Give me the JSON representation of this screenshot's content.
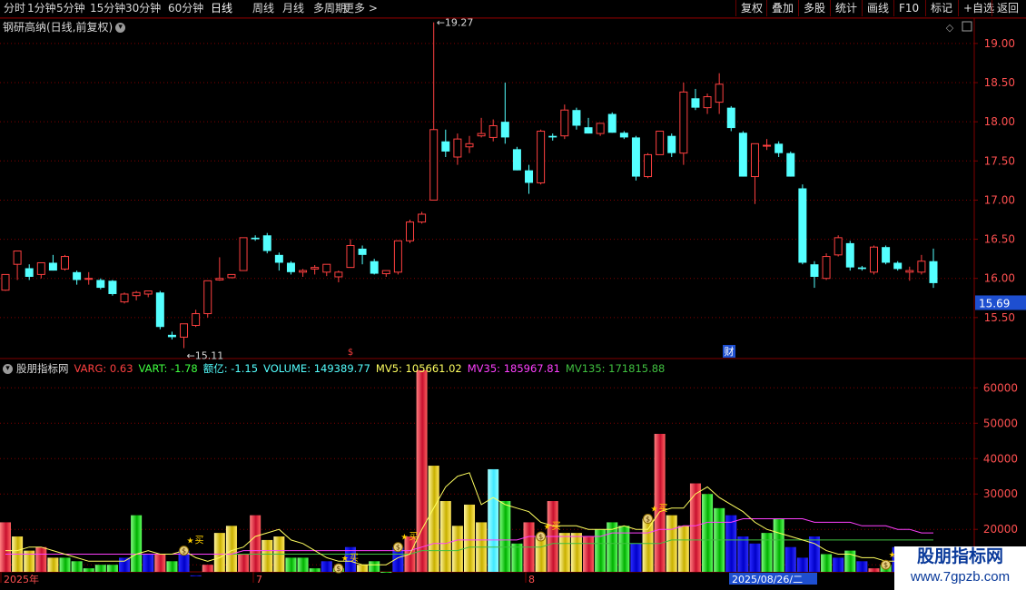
{
  "toolbar": {
    "left": [
      "分时",
      "1分钟",
      "5分钟",
      "15分钟",
      "30分钟",
      "60分钟",
      "日线",
      "周线",
      "月线",
      "多周期",
      "更多 >"
    ],
    "active": "日线",
    "right": [
      "复权",
      "叠加",
      "多股",
      "统计",
      "画线",
      "F10",
      "标记",
      "+自选",
      "返回"
    ]
  },
  "stock_title": "钢研高纳(日线,前复权)",
  "price_axis": {
    "ticks": [
      "19.00",
      "18.50",
      "18.00",
      "17.50",
      "17.00",
      "16.50",
      "16.00",
      "15.50"
    ],
    "current": "15.69",
    "high_label": "19.27",
    "low_label": "15.11"
  },
  "volume_axis": {
    "ticks": [
      "60000",
      "50000",
      "40000",
      "30000",
      "20000",
      "10000"
    ]
  },
  "markers": {
    "dividend": "$",
    "finance": "财"
  },
  "indicator": {
    "name": "股朋指标网",
    "varg": "VARG: 0.63",
    "vart": "VART: -1.78",
    "eyi": "额亿: -1.15",
    "volume": "VOLUME: 149389.77",
    "mv5": "MV5: 105661.02",
    "mv35": "MV35: 185967.81",
    "mv135": "MV135: 171815.88",
    "buy_label": "买"
  },
  "date_axis": {
    "labels": [
      "2025年",
      "7",
      "8"
    ],
    "current_date": "2025/08/26/二"
  },
  "watermark": {
    "line1": "股朋指标网",
    "line2": "www.7gpzb.com"
  },
  "colors": {
    "up": "#ff4040",
    "down": "#54ffff",
    "bg": "#000000",
    "grid": "#800000",
    "mv5": "#ffff60",
    "mv35": "#ff40ff",
    "mv135": "#40c040"
  },
  "chart_data": {
    "type": "candlestick",
    "candles": [
      {
        "o": 15.85,
        "h": 16.05,
        "l": 15.84,
        "c": 16.05
      },
      {
        "o": 16.18,
        "h": 16.35,
        "l": 15.98,
        "c": 16.35
      },
      {
        "o": 16.13,
        "h": 16.18,
        "l": 15.98,
        "c": 16.02
      },
      {
        "o": 16.05,
        "h": 16.2,
        "l": 16.0,
        "c": 16.2
      },
      {
        "o": 16.2,
        "h": 16.3,
        "l": 16.1,
        "c": 16.1
      },
      {
        "o": 16.12,
        "h": 16.3,
        "l": 16.1,
        "c": 16.28
      },
      {
        "o": 16.08,
        "h": 16.1,
        "l": 15.92,
        "c": 15.98
      },
      {
        "o": 16.0,
        "h": 16.08,
        "l": 15.92,
        "c": 16.0
      },
      {
        "o": 15.98,
        "h": 16.0,
        "l": 15.86,
        "c": 15.88
      },
      {
        "o": 15.97,
        "h": 15.98,
        "l": 15.78,
        "c": 15.8
      },
      {
        "o": 15.7,
        "h": 15.82,
        "l": 15.68,
        "c": 15.8
      },
      {
        "o": 15.78,
        "h": 15.84,
        "l": 15.72,
        "c": 15.82
      },
      {
        "o": 15.8,
        "h": 15.84,
        "l": 15.76,
        "c": 15.84
      },
      {
        "o": 15.82,
        "h": 15.84,
        "l": 15.35,
        "c": 15.38
      },
      {
        "o": 15.28,
        "h": 15.32,
        "l": 15.22,
        "c": 15.25
      },
      {
        "o": 15.25,
        "h": 15.42,
        "l": 15.11,
        "c": 15.42
      },
      {
        "o": 15.4,
        "h": 15.6,
        "l": 15.38,
        "c": 15.55
      },
      {
        "o": 15.55,
        "h": 15.97,
        "l": 15.5,
        "c": 15.97
      },
      {
        "o": 15.98,
        "h": 16.27,
        "l": 15.97,
        "c": 16.0
      },
      {
        "o": 16.01,
        "h": 16.05,
        "l": 16.0,
        "c": 16.05
      },
      {
        "o": 16.1,
        "h": 16.52,
        "l": 16.1,
        "c": 16.52
      },
      {
        "o": 16.52,
        "h": 16.55,
        "l": 16.48,
        "c": 16.5
      },
      {
        "o": 16.55,
        "h": 16.58,
        "l": 16.32,
        "c": 16.35
      },
      {
        "o": 16.3,
        "h": 16.33,
        "l": 16.1,
        "c": 16.2
      },
      {
        "o": 16.2,
        "h": 16.22,
        "l": 16.05,
        "c": 16.08
      },
      {
        "o": 16.08,
        "h": 16.12,
        "l": 16.02,
        "c": 16.1
      },
      {
        "o": 16.12,
        "h": 16.17,
        "l": 16.05,
        "c": 16.14
      },
      {
        "o": 16.08,
        "h": 16.18,
        "l": 16.03,
        "c": 16.18
      },
      {
        "o": 16.02,
        "h": 16.1,
        "l": 15.95,
        "c": 16.08
      },
      {
        "o": 16.14,
        "h": 16.5,
        "l": 16.14,
        "c": 16.42
      },
      {
        "o": 16.38,
        "h": 16.42,
        "l": 16.18,
        "c": 16.3
      },
      {
        "o": 16.22,
        "h": 16.25,
        "l": 16.05,
        "c": 16.06
      },
      {
        "o": 16.06,
        "h": 16.1,
        "l": 16.02,
        "c": 16.1
      },
      {
        "o": 16.08,
        "h": 16.48,
        "l": 16.05,
        "c": 16.48
      },
      {
        "o": 16.48,
        "h": 16.75,
        "l": 16.45,
        "c": 16.72
      },
      {
        "o": 16.72,
        "h": 16.85,
        "l": 16.7,
        "c": 16.82
      },
      {
        "o": 17.0,
        "h": 19.27,
        "l": 17.0,
        "c": 17.9
      },
      {
        "o": 17.75,
        "h": 17.9,
        "l": 17.55,
        "c": 17.62
      },
      {
        "o": 17.55,
        "h": 17.85,
        "l": 17.45,
        "c": 17.78
      },
      {
        "o": 17.68,
        "h": 17.82,
        "l": 17.6,
        "c": 17.72
      },
      {
        "o": 17.82,
        "h": 18.05,
        "l": 17.8,
        "c": 17.85
      },
      {
        "o": 17.8,
        "h": 18.03,
        "l": 17.75,
        "c": 17.95
      },
      {
        "o": 18.0,
        "h": 18.5,
        "l": 17.72,
        "c": 17.8
      },
      {
        "o": 17.65,
        "h": 17.68,
        "l": 17.38,
        "c": 17.38
      },
      {
        "o": 17.38,
        "h": 17.45,
        "l": 17.08,
        "c": 17.22
      },
      {
        "o": 17.22,
        "h": 17.9,
        "l": 17.2,
        "c": 17.88
      },
      {
        "o": 17.82,
        "h": 17.85,
        "l": 17.76,
        "c": 17.8
      },
      {
        "o": 17.82,
        "h": 18.22,
        "l": 17.78,
        "c": 18.15
      },
      {
        "o": 18.15,
        "h": 18.18,
        "l": 17.9,
        "c": 17.95
      },
      {
        "o": 17.93,
        "h": 18.05,
        "l": 17.85,
        "c": 17.85
      },
      {
        "o": 17.85,
        "h": 17.98,
        "l": 17.82,
        "c": 17.98
      },
      {
        "o": 18.1,
        "h": 18.12,
        "l": 17.86,
        "c": 17.86
      },
      {
        "o": 17.86,
        "h": 17.88,
        "l": 17.78,
        "c": 17.8
      },
      {
        "o": 17.8,
        "h": 17.82,
        "l": 17.25,
        "c": 17.3
      },
      {
        "o": 17.3,
        "h": 17.6,
        "l": 17.28,
        "c": 17.58
      },
      {
        "o": 17.58,
        "h": 17.88,
        "l": 17.58,
        "c": 17.88
      },
      {
        "o": 17.82,
        "h": 17.85,
        "l": 17.55,
        "c": 17.6
      },
      {
        "o": 17.6,
        "h": 18.5,
        "l": 17.45,
        "c": 18.38
      },
      {
        "o": 18.3,
        "h": 18.42,
        "l": 18.15,
        "c": 18.18
      },
      {
        "o": 18.18,
        "h": 18.36,
        "l": 18.1,
        "c": 18.32
      },
      {
        "o": 18.25,
        "h": 18.62,
        "l": 18.1,
        "c": 18.48
      },
      {
        "o": 18.18,
        "h": 18.2,
        "l": 17.88,
        "c": 17.92
      },
      {
        "o": 17.86,
        "h": 17.88,
        "l": 17.3,
        "c": 17.3
      },
      {
        "o": 17.3,
        "h": 17.72,
        "l": 16.95,
        "c": 17.72
      },
      {
        "o": 17.7,
        "h": 17.78,
        "l": 17.64,
        "c": 17.7
      },
      {
        "o": 17.72,
        "h": 17.75,
        "l": 17.55,
        "c": 17.6
      },
      {
        "o": 17.6,
        "h": 17.62,
        "l": 17.3,
        "c": 17.3
      },
      {
        "o": 17.15,
        "h": 17.2,
        "l": 16.18,
        "c": 16.2
      },
      {
        "o": 16.18,
        "h": 16.22,
        "l": 15.88,
        "c": 16.02
      },
      {
        "o": 16.0,
        "h": 16.32,
        "l": 15.98,
        "c": 16.28
      },
      {
        "o": 16.3,
        "h": 16.55,
        "l": 16.28,
        "c": 16.52
      },
      {
        "o": 16.45,
        "h": 16.48,
        "l": 16.1,
        "c": 16.14
      },
      {
        "o": 16.14,
        "h": 16.16,
        "l": 16.1,
        "c": 16.12
      },
      {
        "o": 16.08,
        "h": 16.42,
        "l": 16.05,
        "c": 16.4
      },
      {
        "o": 16.4,
        "h": 16.42,
        "l": 16.18,
        "c": 16.2
      },
      {
        "o": 16.2,
        "h": 16.22,
        "l": 16.1,
        "c": 16.12
      },
      {
        "o": 16.08,
        "h": 16.15,
        "l": 15.97,
        "c": 16.1
      },
      {
        "o": 16.08,
        "h": 16.3,
        "l": 16.05,
        "c": 16.22
      },
      {
        "o": 16.22,
        "h": 16.38,
        "l": 15.88,
        "c": 15.94
      }
    ],
    "volume": [
      22,
      18,
      14,
      15,
      12,
      12,
      11,
      9,
      10,
      10,
      12,
      24,
      13,
      13,
      11,
      14,
      7,
      10,
      19,
      21,
      13,
      24,
      17,
      18,
      12,
      12,
      9,
      11,
      9,
      15,
      10,
      11,
      8,
      15,
      18,
      65,
      38,
      28,
      21,
      27,
      22,
      37,
      28,
      16,
      22,
      18,
      28,
      19,
      19,
      18,
      20,
      22,
      21,
      16,
      23,
      47,
      24,
      21,
      33,
      30,
      26,
      24,
      18,
      16,
      19,
      23,
      15,
      12,
      18,
      13,
      12,
      14,
      11,
      9,
      10,
      15,
      11,
      9,
      15
    ],
    "mv5": [
      14,
      14,
      15,
      15,
      14,
      13,
      12,
      11,
      11,
      11,
      11,
      13,
      14,
      13,
      13,
      14,
      12,
      11,
      12,
      14,
      15,
      18,
      19,
      20,
      17,
      16,
      14,
      12,
      11,
      11,
      10,
      10,
      10,
      12,
      13,
      20,
      26,
      32,
      35,
      36,
      27,
      29,
      27,
      26,
      25,
      22,
      21,
      21,
      21,
      20,
      20,
      20,
      21,
      20,
      20,
      25,
      26,
      26,
      30,
      32,
      29,
      27,
      25,
      22,
      20,
      19,
      18,
      17,
      16,
      14,
      13,
      13,
      12,
      12,
      11,
      11,
      10,
      10,
      11
    ],
    "mv35": [
      13,
      13,
      13,
      13,
      13,
      13,
      13,
      13,
      13,
      13,
      13,
      13,
      13,
      13,
      13,
      13,
      13,
      13,
      13,
      13,
      14,
      14,
      14,
      14,
      14,
      14,
      14,
      14,
      14,
      14,
      14,
      14,
      14,
      14,
      14,
      15,
      16,
      16,
      17,
      17,
      17,
      17,
      17,
      17,
      18,
      18,
      18,
      18,
      18,
      18,
      18,
      19,
      19,
      19,
      19,
      20,
      20,
      21,
      21,
      22,
      22,
      22,
      23,
      23,
      23,
      23,
      23,
      23,
      22,
      22,
      22,
      22,
      21,
      21,
      21,
      20,
      20,
      19,
      19
    ],
    "mv135": [
      13,
      13,
      13,
      13,
      13,
      13,
      13,
      13,
      13,
      13,
      13,
      13,
      13,
      13,
      13,
      13,
      13,
      13,
      13,
      13,
      13,
      13,
      13,
      13,
      13,
      13,
      13,
      13,
      13,
      13,
      13,
      13,
      13,
      13,
      13,
      14,
      14,
      14,
      14,
      15,
      15,
      15,
      15,
      15,
      15,
      15,
      16,
      16,
      16,
      16,
      16,
      16,
      16,
      16,
      16,
      16,
      17,
      17,
      17,
      17,
      17,
      17,
      17,
      17,
      17,
      17,
      17,
      17,
      17,
      17,
      17,
      17,
      17,
      17,
      17,
      17,
      17,
      17,
      17
    ],
    "vol_colors": [
      "r",
      "y",
      "y",
      "r",
      "y",
      "g",
      "g",
      "g",
      "g",
      "g",
      "b",
      "g",
      "b",
      "r",
      "g",
      "b",
      "b",
      "r",
      "y",
      "y",
      "r",
      "r",
      "y",
      "y",
      "g",
      "g",
      "g",
      "b",
      "g",
      "b",
      "y",
      "g",
      "g",
      "b",
      "r",
      "r",
      "y",
      "y",
      "y",
      "y",
      "y",
      "c",
      "g",
      "g",
      "r",
      "y",
      "r",
      "y",
      "y",
      "r",
      "g",
      "g",
      "g",
      "b",
      "y",
      "r",
      "y",
      "y",
      "r",
      "g",
      "g",
      "b",
      "b",
      "b",
      "g",
      "g",
      "b",
      "b",
      "b",
      "g",
      "b",
      "g",
      "b",
      "r",
      "g",
      "b",
      "b",
      "g",
      "g"
    ],
    "buy_idx": [
      15,
      28,
      33,
      45,
      54,
      74,
      77
    ],
    "ylim": [
      15.0,
      19.3
    ],
    "vol_ylim": [
      8,
      67
    ]
  }
}
